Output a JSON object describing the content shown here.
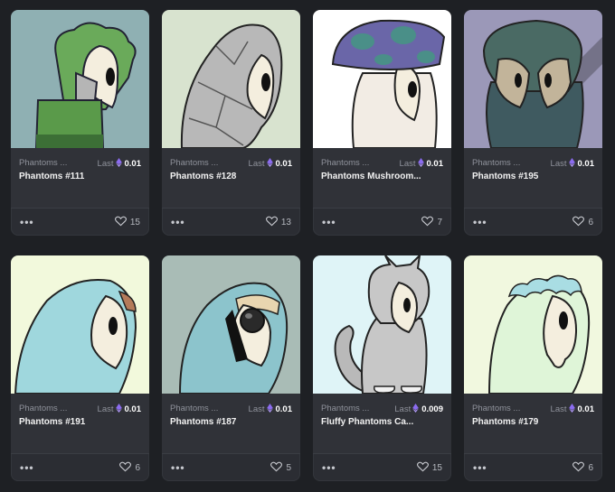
{
  "colors": {
    "page_bg": "#1e2024",
    "card_bg": "#2b2d33",
    "eth_purple": "#8c6cf0"
  },
  "currency_icon": "eth-icon",
  "more_icon": "more-dots-icon",
  "like_icon": "heart-icon",
  "cards": [
    {
      "collection": "Phantoms ...",
      "last_label": "Last",
      "price": "0.01",
      "name": "Phantoms #111",
      "likes": "15",
      "art_bg": "#8fb0b3",
      "art": "green-curly-hair-armor"
    },
    {
      "collection": "Phantoms ...",
      "last_label": "Last",
      "price": "0.01",
      "name": "Phantoms #128",
      "likes": "13",
      "art_bg": "#d8e3cf",
      "art": "silver-plated-hood"
    },
    {
      "collection": "Phantoms ...",
      "last_label": "Last",
      "price": "0.01",
      "name": "Phantoms Mushroom...",
      "likes": "7",
      "art_bg": "#ffffff",
      "art": "mushroom-cap"
    },
    {
      "collection": "Phantoms ...",
      "last_label": "Last",
      "price": "0.01",
      "name": "Phantoms #195",
      "likes": "6",
      "art_bg": "#9b98b8",
      "art": "dark-owl-hood"
    },
    {
      "collection": "Phantoms ...",
      "last_label": "Last",
      "price": "0.01",
      "name": "Phantoms #191",
      "likes": "6",
      "art_bg": "#f2f9dc",
      "art": "light-blue-hood"
    },
    {
      "collection": "Phantoms ...",
      "last_label": "Last",
      "price": "0.01",
      "name": "Phantoms #187",
      "likes": "5",
      "art_bg": "#a9bcb6",
      "art": "teal-hood-eyepatch"
    },
    {
      "collection": "Phantoms ...",
      "last_label": "Last",
      "price": "0.009",
      "name": "Fluffy Phantoms Ca...",
      "likes": "15",
      "art_bg": "#dff4f7",
      "art": "grey-cat-costume"
    },
    {
      "collection": "Phantoms ...",
      "last_label": "Last",
      "price": "0.01",
      "name": "Phantoms #179",
      "likes": "6",
      "art_bg": "#f1f8df",
      "art": "mint-dripping-hood"
    }
  ]
}
